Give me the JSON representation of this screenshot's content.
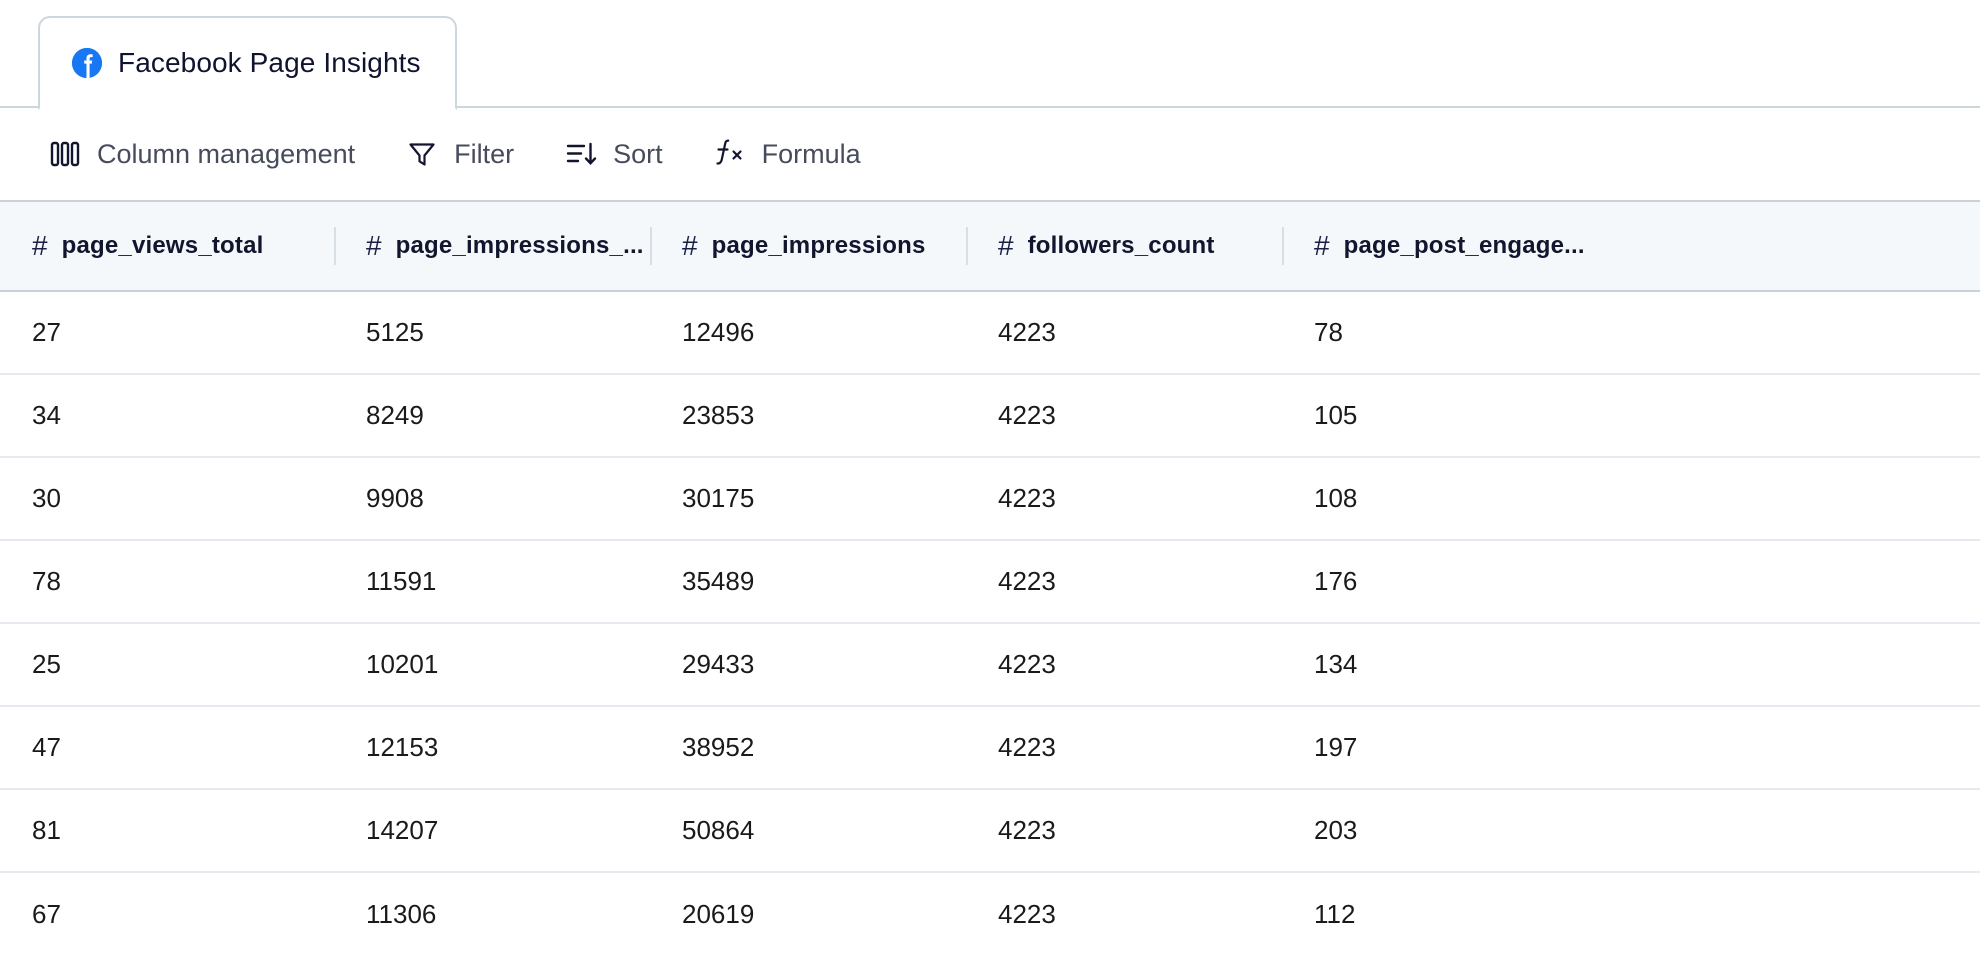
{
  "tab": {
    "label": "Facebook Page Insights",
    "icon": "facebook-icon",
    "active": true
  },
  "toolbar": {
    "column_management_label": "Column management",
    "column_management_icon": "columns-icon",
    "filter_label": "Filter",
    "filter_icon": "filter-funnel-icon",
    "sort_label": "Sort",
    "sort_icon": "sort-descending-icon",
    "formula_label": "Formula",
    "formula_icon": "function-fx-icon"
  },
  "table": {
    "columns": [
      {
        "name": "page_views_total",
        "type_icon": "#"
      },
      {
        "name": "page_impressions_...",
        "type_icon": "#"
      },
      {
        "name": "page_impressions",
        "type_icon": "#"
      },
      {
        "name": "followers_count",
        "type_icon": "#"
      },
      {
        "name": "page_post_engage...",
        "type_icon": "#"
      }
    ],
    "rows": [
      [
        "27",
        "5125",
        "12496",
        "4223",
        "78"
      ],
      [
        "34",
        "8249",
        "23853",
        "4223",
        "105"
      ],
      [
        "30",
        "9908",
        "30175",
        "4223",
        "108"
      ],
      [
        "78",
        "11591",
        "35489",
        "4223",
        "176"
      ],
      [
        "25",
        "10201",
        "29433",
        "4223",
        "134"
      ],
      [
        "47",
        "12153",
        "38952",
        "4223",
        "197"
      ],
      [
        "81",
        "14207",
        "50864",
        "4223",
        "203"
      ],
      [
        "67",
        "11306",
        "20619",
        "4223",
        "112"
      ]
    ]
  },
  "colors": {
    "brand_facebook": "#1877f2",
    "header_bg": "#f5f8fa",
    "header_border": "#c9d2da",
    "row_border": "#e6eaf0",
    "text_primary": "#12152e",
    "text_muted": "#474c5c"
  }
}
